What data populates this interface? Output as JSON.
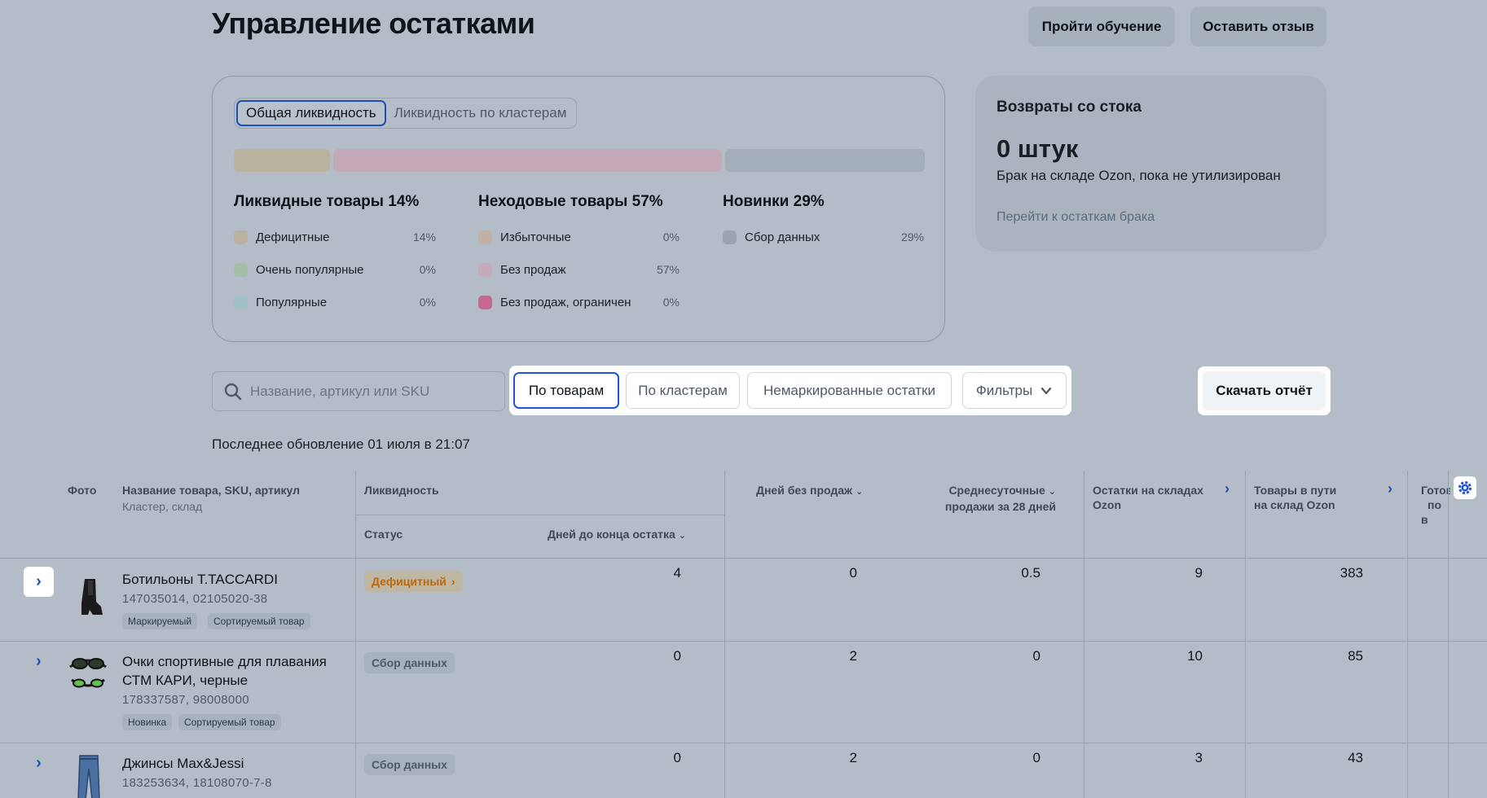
{
  "header": {
    "title": "Управление остатками",
    "learn_button": "Пройти обучение",
    "review_button": "Оставить отзыв"
  },
  "liquidity": {
    "tabs": [
      "Общая ликвидность",
      "Ликвидность по кластерам"
    ],
    "active_tab": "Общая ликвидность",
    "bar_shares": {
      "liquid": 14,
      "dead": 57,
      "new": 29
    },
    "groups": [
      {
        "title": "Ликвидные товары 14%",
        "items": [
          {
            "label": "Дефицитные",
            "value": "14%",
            "color": "#bab19f"
          },
          {
            "label": "Очень популярные",
            "value": "0%",
            "color": "#a3bfa7"
          },
          {
            "label": "Популярные",
            "value": "0%",
            "color": "#a2c0c9"
          }
        ]
      },
      {
        "title": "Неходовые товары 57%",
        "items": [
          {
            "label": "Избыточные",
            "value": "0%",
            "color": "#c2b0a6"
          },
          {
            "label": "Без продаж",
            "value": "57%",
            "color": "#c5abb9"
          },
          {
            "label": "Без продаж, ограничен",
            "value": "0%",
            "color": "#c6688e"
          }
        ]
      },
      {
        "title": "Новинки 29%",
        "items": [
          {
            "label": "Сбор данных",
            "value": "29%",
            "color": "#9aa4b0"
          }
        ]
      }
    ]
  },
  "returns": {
    "title": "Возвраты со стока",
    "count": "0 штук",
    "description": "Брак на складе Ozon, пока не утилизирован",
    "link": "Перейти к остаткам брака"
  },
  "toolbar": {
    "search_placeholder": "Название, артикул или SKU",
    "tabs": [
      "По товарам",
      "По кластерам",
      "Немаркированные остатки"
    ],
    "active_tab": "По товарам",
    "filters_label": "Фильтры",
    "download_label": "Скачать отчёт",
    "last_update": "Последнее обновление 01 июля в 21:07"
  },
  "table": {
    "headers": {
      "photo": "Фото",
      "name": "Название товара, SKU, артикул",
      "name_sub": "Кластер, склад",
      "liquidity": "Ликвидность",
      "status": "Статус",
      "days_to_end": "Дней до конца остатка",
      "days_no_sales": "Дней без продаж",
      "avg_sales_1": "Среднесуточные",
      "avg_sales_2": "продажи за 28 дней",
      "stock_1": "Остатки на складах",
      "stock_2": "Ozon",
      "transit_1": "Товары в пути",
      "transit_2": "на склад Ozon",
      "ready_1": "Готов",
      "ready_2": "по в"
    },
    "rows": [
      {
        "name": "Ботильоны T.TACCARDI",
        "sku": "147035014, 02105020-38",
        "tags": [
          "Маркируемый",
          "Сортируемый товар"
        ],
        "status": "Дефицитный",
        "status_kind": "orange",
        "days_to_end": "4",
        "days_no_sales": "0",
        "avg_sales": "0.5",
        "stock": "9",
        "transit": "383"
      },
      {
        "name": "Очки спортивные для плавания СТМ КАРИ, черные",
        "sku": "178337587, 98008000",
        "tags": [
          "Новинка",
          "Сортируемый товар"
        ],
        "status": "Сбор данных",
        "status_kind": "grey",
        "days_to_end": "0",
        "days_no_sales": "2",
        "avg_sales": "0",
        "stock": "10",
        "transit": "85"
      },
      {
        "name": "Джинсы Max&Jessi",
        "sku": "183253634, 18108070-7-8",
        "tags": [],
        "status": "Сбор данных",
        "status_kind": "grey",
        "days_to_end": "0",
        "days_no_sales": "2",
        "avg_sales": "0",
        "stock": "3",
        "transit": "43"
      }
    ]
  },
  "colors": {
    "accent": "#1d4fb5",
    "background": "#b4bdc7",
    "deficit_text": "#b8690e"
  },
  "icons": [
    "search-icon",
    "chevron-down-icon",
    "chevron-right-icon",
    "gear-icon",
    "boot-icon",
    "goggles-icon",
    "jeans-icon"
  ]
}
